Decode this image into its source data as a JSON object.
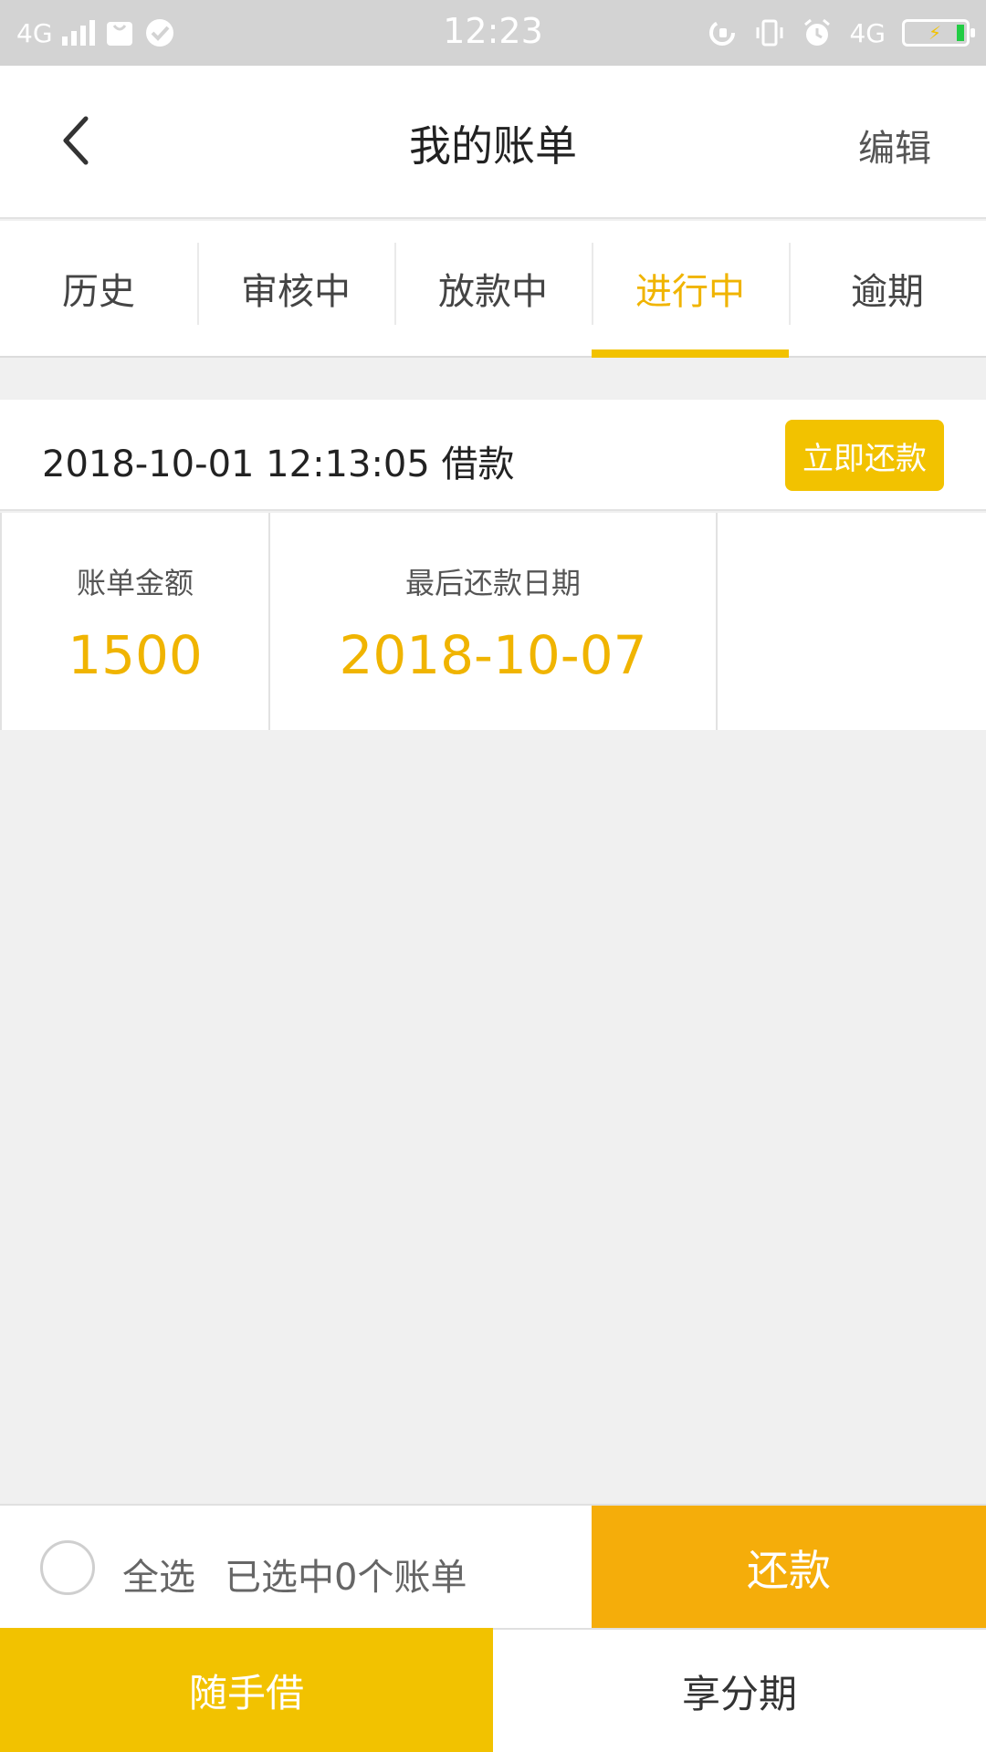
{
  "status_bar": {
    "network": "4G",
    "time": "12:23",
    "network_right": "4G"
  },
  "header": {
    "title": "我的账单",
    "edit_label": "编辑"
  },
  "tabs": [
    {
      "label": "历史"
    },
    {
      "label": "审核中"
    },
    {
      "label": "放款中"
    },
    {
      "label": "进行中"
    },
    {
      "label": "逾期"
    }
  ],
  "active_tab": 3,
  "bill": {
    "loan_time": "2018-10-01 12:13:05 借款",
    "repay_now_label": "立即还款",
    "amount_label": "账单金额",
    "amount_value": "1500",
    "due_label": "最后还款日期",
    "due_value": "2018-10-07"
  },
  "selection": {
    "select_all_label": "全选",
    "selected_count_text": "已选中0个账单",
    "repay_label": "还款"
  },
  "bottom_nav": [
    {
      "label": "随手借"
    },
    {
      "label": "享分期"
    }
  ],
  "colors": {
    "accent": "#f2c200",
    "accent_text": "#f0b400",
    "repay_orange": "#f5ad0a",
    "status_bar": "#d3d3d3",
    "background": "#f0f0f0"
  }
}
